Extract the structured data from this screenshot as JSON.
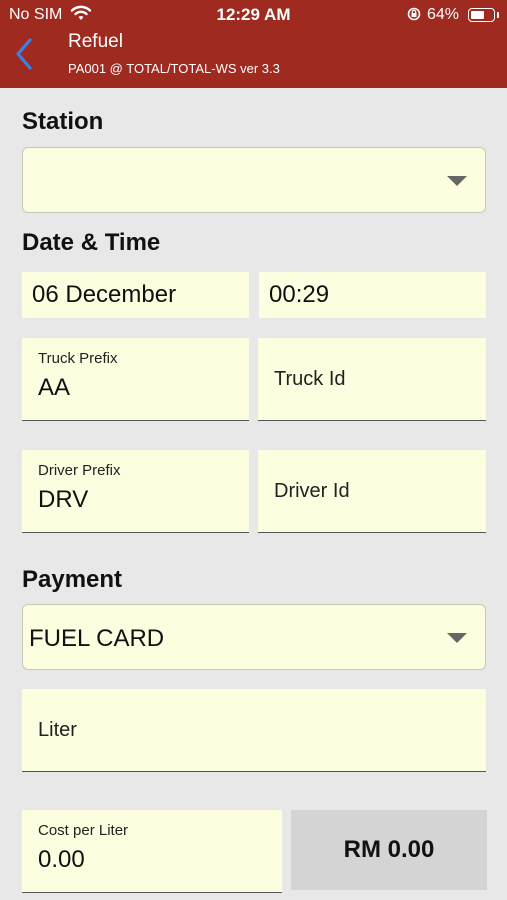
{
  "status_bar": {
    "carrier": "No SIM",
    "time": "12:29 AM",
    "battery_percent": "64%",
    "battery_level": 0.64
  },
  "nav": {
    "title": "Refuel",
    "subtitle": "PA001 @ TOTAL/TOTAL-WS ver 3.3",
    "back_icon": "chevron-left-icon"
  },
  "station": {
    "title": "Station",
    "selected": ""
  },
  "datetime": {
    "title": "Date & Time",
    "date": "06 December",
    "time": "00:29"
  },
  "truck": {
    "prefix_label": "Truck Prefix",
    "prefix_value": "AA",
    "id_placeholder": "Truck Id"
  },
  "driver": {
    "prefix_label": "Driver Prefix",
    "prefix_value": "DRV",
    "id_placeholder": "Driver Id"
  },
  "payment": {
    "title": "Payment",
    "method": "FUEL CARD",
    "liter_placeholder": "Liter",
    "cost_label": "Cost per Liter",
    "cost_value": "0.00",
    "total": "RM 0.00"
  },
  "colors": {
    "header": "#9e2a20",
    "field_background": "#fdfde0",
    "page_background": "#e8e8e8",
    "back_arrow": "#3b7fe8"
  }
}
